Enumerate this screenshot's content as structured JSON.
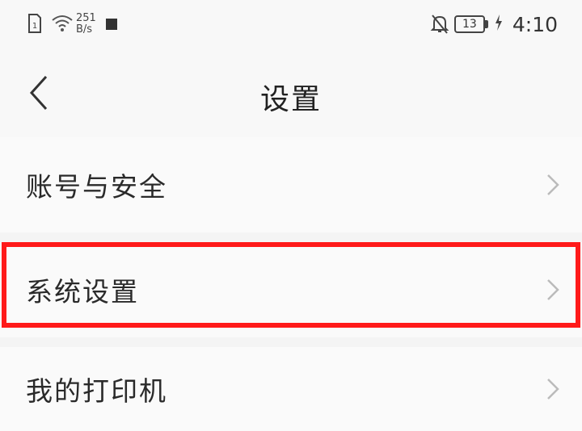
{
  "status_bar": {
    "net_speed_value": "251",
    "net_speed_unit": "B/s",
    "battery_level": "13",
    "time": "4:10"
  },
  "nav": {
    "title": "设置"
  },
  "settings_items": [
    {
      "label": "账号与安全"
    },
    {
      "label": "系统设置"
    },
    {
      "label": "我的打印机"
    }
  ],
  "colors": {
    "highlight": "#ff1a1a",
    "background": "#f4f4f4",
    "row_background": "#fafafa"
  }
}
